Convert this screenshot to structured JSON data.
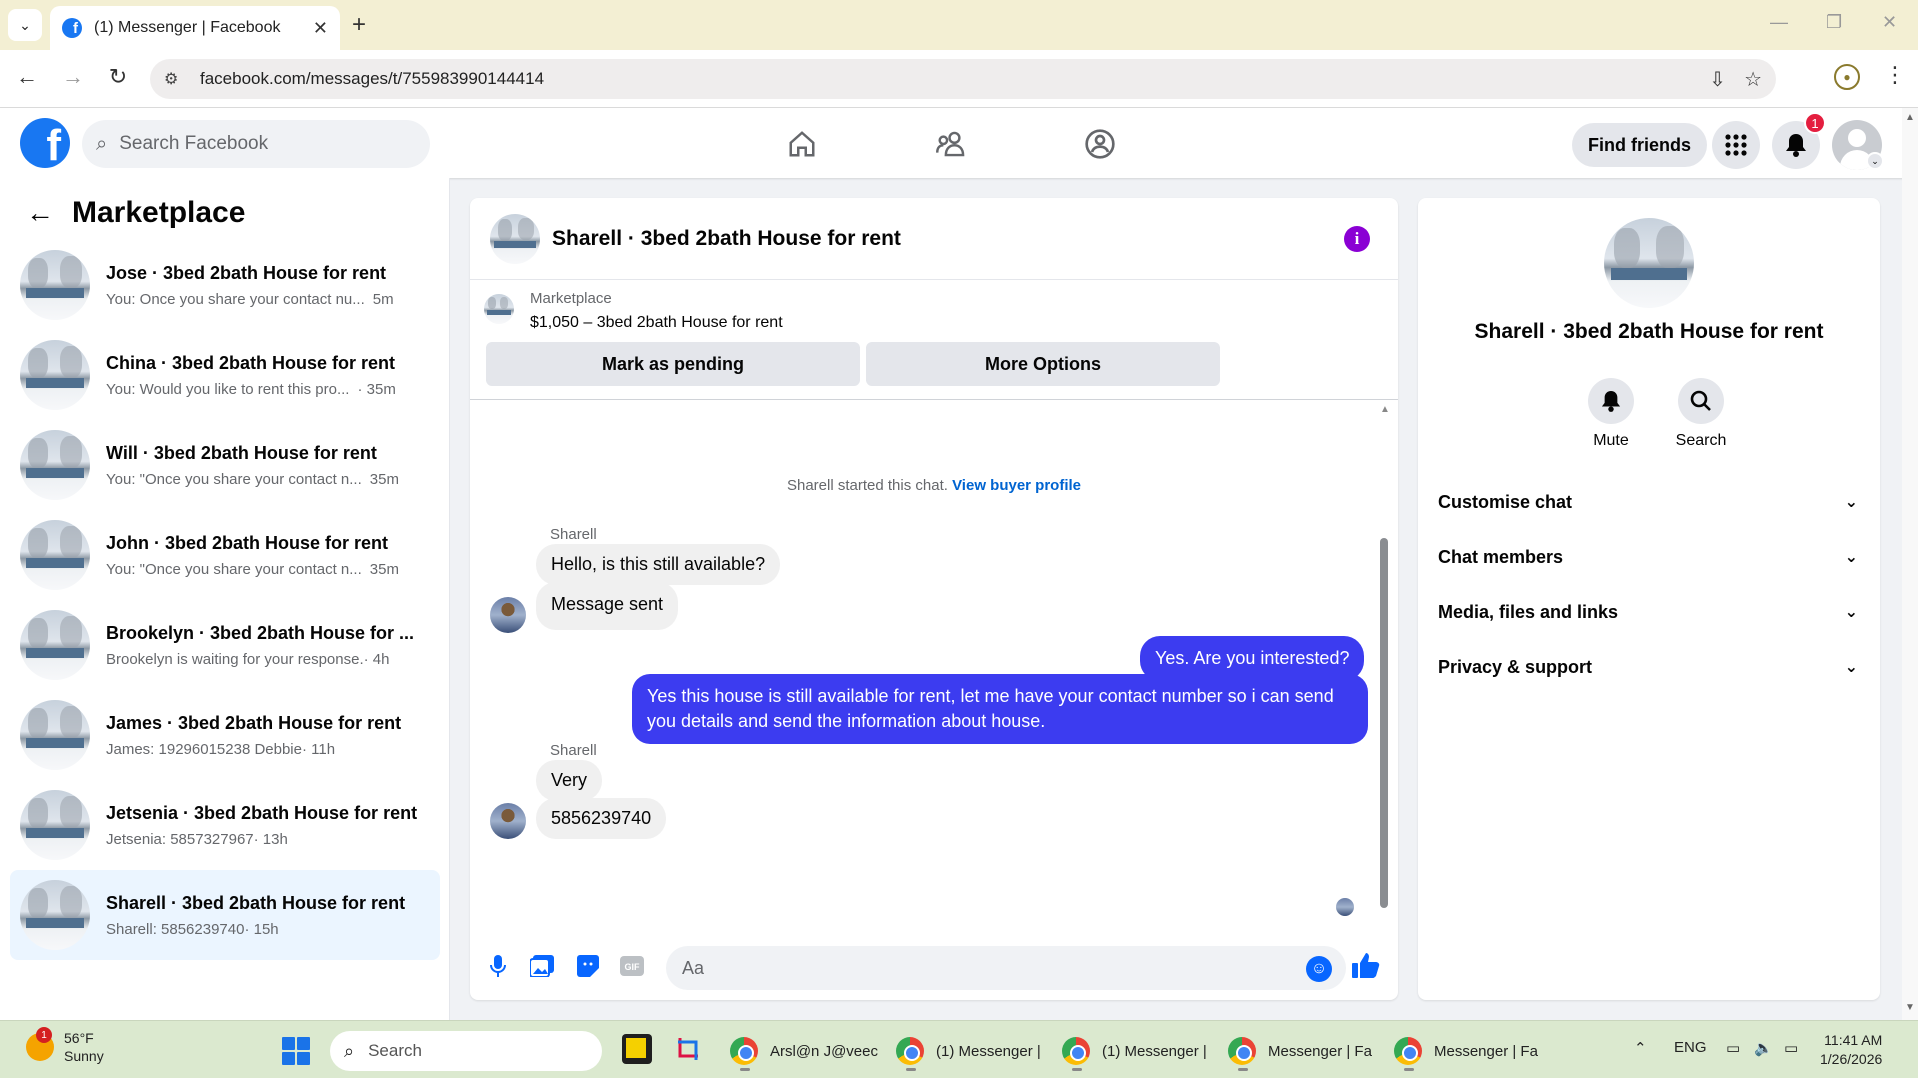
{
  "browser": {
    "tab_title": "(1) Messenger | Facebook",
    "url": "facebook.com/messages/t/755983990144414"
  },
  "header": {
    "search_placeholder": "Search Facebook",
    "find_friends": "Find friends",
    "notification_count": "1"
  },
  "sidebar": {
    "title": "Marketplace",
    "conversations": [
      {
        "name": "Jose · 3bed 2bath House for rent",
        "preview": "You: Once you share your contact nu...",
        "time": "5m"
      },
      {
        "name": "China · 3bed 2bath House for rent",
        "preview": "You: Would you like to rent this pro...",
        "time": "· 35m"
      },
      {
        "name": "Will · 3bed 2bath House for rent",
        "preview": "You: \"Once you share your contact n...",
        "time": "35m"
      },
      {
        "name": "John · 3bed 2bath House for rent",
        "preview": "You: \"Once you share your contact n...",
        "time": "35m"
      },
      {
        "name": "Brookelyn · 3bed 2bath House for ...",
        "preview": "Brookelyn is waiting for your response.",
        "time": "· 4h"
      },
      {
        "name": "James · 3bed 2bath House for rent",
        "preview": "James: 19296015238 Debbie",
        "time": "· 11h"
      },
      {
        "name": "Jetsenia · 3bed 2bath House for rent",
        "preview": "Jetsenia: 5857327967",
        "time": "· 13h"
      },
      {
        "name": "Sharell · 3bed 2bath House for rent",
        "preview": "Sharell: 5856239740",
        "time": "· 15h"
      }
    ]
  },
  "chat": {
    "title": "Sharell · 3bed 2bath House for rent",
    "marketplace_label": "Marketplace",
    "listing": "$1,050 – 3bed 2bath House for rent",
    "mark_pending": "Mark as pending",
    "more_options": "More Options",
    "system_text": "Sharell started this chat.",
    "system_link": "View buyer profile",
    "sender1": "Sharell",
    "msg1": "Hello, is this still available?",
    "msg2": "Message sent",
    "out1": "Yes. Are you interested?",
    "out2": "Yes this house is still available for rent, let me have your contact number so i can send you details and send the information about house.",
    "sender2": "Sharell",
    "msg3": "Very",
    "msg4": "5856239740",
    "composer_placeholder": "Aa"
  },
  "info_panel": {
    "name": "Sharell · 3bed 2bath House for rent",
    "mute": "Mute",
    "search": "Search",
    "sections": [
      "Customise chat",
      "Chat members",
      "Media, files and links",
      "Privacy & support"
    ]
  },
  "taskbar": {
    "weather_temp": "56°F",
    "weather_cond": "Sunny",
    "weather_badge": "1",
    "search": "Search",
    "windows": [
      "Arsl@n J@veec",
      "(1) Messenger |",
      "(1) Messenger |",
      "Messenger | Fa",
      "Messenger | Fa"
    ],
    "lang": "ENG",
    "time": "11:41 AM",
    "date": "1/26/2026"
  },
  "colors": {
    "fb_blue": "#1877f2",
    "outgoing_bubble": "#3c3cf0",
    "active_convo": "#ebf5ff",
    "info_purple": "#8a00d4"
  }
}
